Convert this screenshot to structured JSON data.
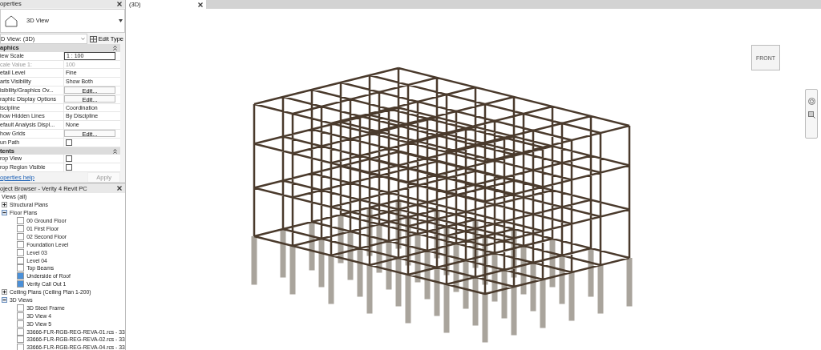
{
  "properties": {
    "title": "operties",
    "type_name": "3D View",
    "instance": "D View: (3D)",
    "edit_type": "Edit Type",
    "sections": [
      {
        "title": "aphics",
        "rows": [
          {
            "kind": "input",
            "label": "iew Scale",
            "value": "1 : 100",
            "disabled": false
          },
          {
            "kind": "text",
            "label": "cale Value    1:",
            "value": "100",
            "disabled": true
          },
          {
            "kind": "text",
            "label": "etail Level",
            "value": "Fine",
            "disabled": false
          },
          {
            "kind": "text",
            "label": "arts Visibility",
            "value": "Show Both",
            "disabled": false
          },
          {
            "kind": "button",
            "label": "isibility/Graphics Ov...",
            "value": "Edit...",
            "disabled": false
          },
          {
            "kind": "button",
            "label": "raphic Display Options",
            "value": "Edit...",
            "disabled": false
          },
          {
            "kind": "text",
            "label": "iscipline",
            "value": "Coordination",
            "disabled": false
          },
          {
            "kind": "text",
            "label": "how Hidden Lines",
            "value": "By Discipline",
            "disabled": false
          },
          {
            "kind": "text",
            "label": "efault Analysis Displ...",
            "value": "None",
            "disabled": false
          },
          {
            "kind": "button",
            "label": "how Grids",
            "value": "Edit...",
            "disabled": false
          },
          {
            "kind": "checkbox",
            "label": "un Path",
            "checked": false,
            "disabled": false
          }
        ]
      },
      {
        "title": "tents",
        "rows": [
          {
            "kind": "checkbox",
            "label": "rop View",
            "checked": false,
            "disabled": false
          },
          {
            "kind": "checkbox",
            "label": "rop Region Visible",
            "checked": false,
            "disabled": false
          }
        ]
      }
    ],
    "help_link": "operties help",
    "apply": "Apply"
  },
  "browser": {
    "title": "oject Browser - Verity 4 Revit PC",
    "root": "Views (all)",
    "tree": [
      {
        "label": "Structural Plans",
        "expanded": false
      },
      {
        "label": "Floor Plans",
        "expanded": true,
        "children": [
          {
            "label": "00 Ground Floor",
            "open": false
          },
          {
            "label": "01 First Floor",
            "open": false
          },
          {
            "label": "02 Second Floor",
            "open": false
          },
          {
            "label": "Foundation Level",
            "open": false
          },
          {
            "label": "Level 03",
            "open": false
          },
          {
            "label": "Level 04",
            "open": false
          },
          {
            "label": "Top Beams",
            "open": false
          },
          {
            "label": "Underside of Roof",
            "open": true
          },
          {
            "label": "Verity Call Out 1",
            "open": true
          }
        ]
      },
      {
        "label": "Ceiling Plans (Ceiling Plan 1-200)",
        "expanded": false
      },
      {
        "label": "3D Views",
        "expanded": true,
        "children": [
          {
            "label": "3D Steel Frame",
            "open": false
          },
          {
            "label": "3D View 4",
            "open": false
          },
          {
            "label": "3D View 5",
            "open": false
          },
          {
            "label": "33666-FLR-RGB-REG-REVA-01.rcs - 33",
            "open": false
          },
          {
            "label": "33666-FLR-RGB-REG-REVA-02.rcs - 33",
            "open": false
          },
          {
            "label": "33666-FLR-RGB-REG-REVA-04.rcs - 33",
            "open": false
          }
        ]
      }
    ]
  },
  "view_tab": {
    "label": "(3D)",
    "selected": true
  },
  "view_cube": {
    "face": "FRONT"
  }
}
